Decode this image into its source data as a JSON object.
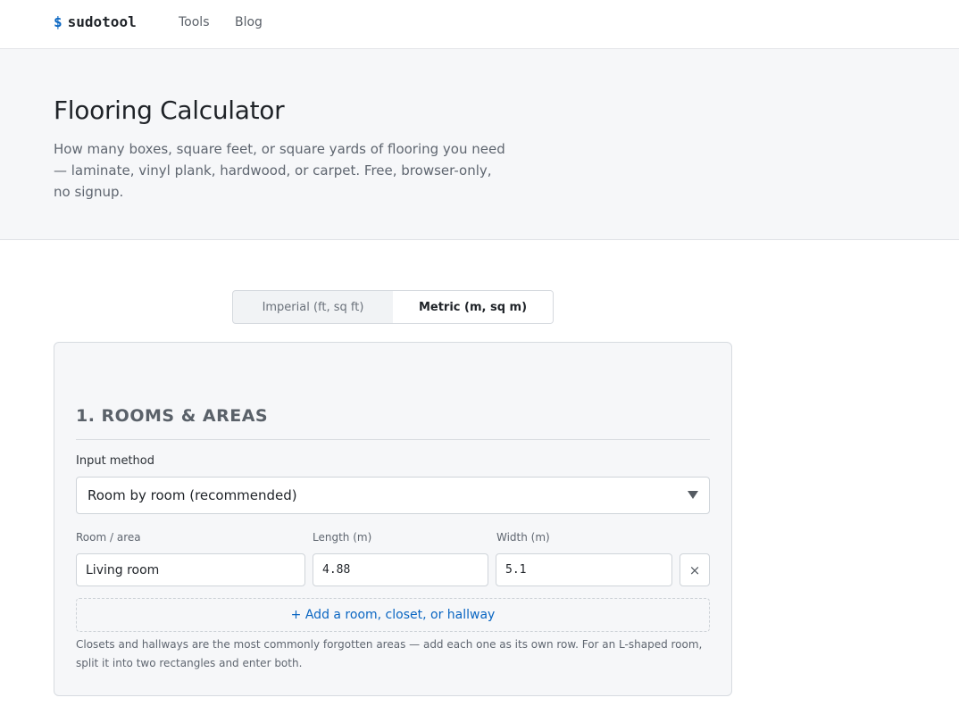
{
  "nav": {
    "logo_prefix": "$",
    "logo_text": "sudotool",
    "links": [
      "Tools",
      "Blog"
    ]
  },
  "hero": {
    "title": "Flooring Calculator",
    "description": "How many boxes, square feet, or square yards of flooring you need — laminate, vinyl plank, hardwood, or carpet. Free, browser-only, no signup."
  },
  "unit_toggle": {
    "options": [
      "Imperial (ft, sq ft)",
      "Metric (m, sq m)"
    ],
    "selected": "Metric (m, sq m)"
  },
  "rooms": {
    "section_title": "1. ROOMS & AREAS",
    "input_method_label": "Input method",
    "input_method_value": "Room by room (recommended)",
    "columns": [
      "Room / area",
      "Length (m)",
      "Width (m)"
    ],
    "rows": [
      {
        "name": "Living room",
        "length": "4.88",
        "width": "5.1"
      }
    ],
    "remove_label": "×",
    "add_button": "+ Add a room, closet, or hallway",
    "hint": "Closets and hallways are the most commonly forgotten areas — add each one as its own row. For an L-shaped room, split it into two rectangles and enter both."
  },
  "colors": {
    "accent": "#0a66c2",
    "hero_bg": "#f6f7f9"
  }
}
